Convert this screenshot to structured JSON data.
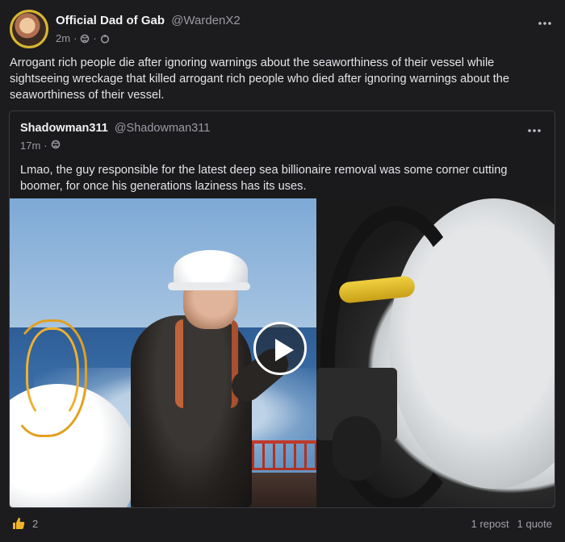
{
  "post": {
    "author_name": "Official Dad of Gab",
    "author_handle": "@WardenX2",
    "time": "2m",
    "text": "Arrogant rich people die after ignoring warnings about the seaworthiness of their vessel while sightseeing wreckage that killed arrogant rich people who died after ignoring warnings about the seaworthiness of their vessel.",
    "more_icon": "ellipsis-icon"
  },
  "quote": {
    "author_name": "Shadowman311",
    "author_handle": "@Shadowman311",
    "time": "17m",
    "text": "Lmao, the guy responsible for the latest deep sea billionaire removal was some corner cutting boomer, for once his generations laziness has its uses."
  },
  "footer": {
    "like_count": "2",
    "reposts": "1 repost",
    "quotes": "1 quote"
  },
  "colors": {
    "background": "#1c1c1f",
    "avatar_ring": "#d8b630",
    "like_icon": "#f0b429"
  }
}
